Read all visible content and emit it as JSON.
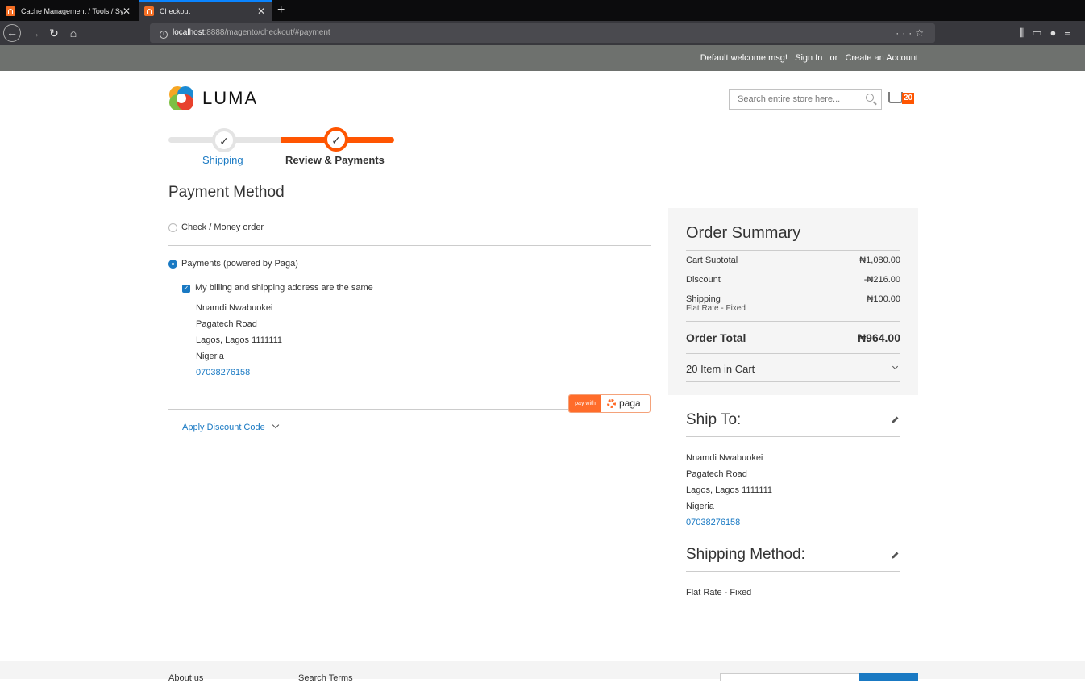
{
  "browser": {
    "tabs": [
      {
        "label": "Cache Management / Tools / Sy"
      },
      {
        "label": "Checkout"
      }
    ],
    "url_host": "localhost",
    "url_path": ":8888/magento/checkout/#payment"
  },
  "header": {
    "welcome": "Default welcome msg!",
    "sign_in": "Sign In",
    "or": "or",
    "create_account": "Create an Account",
    "logo_text": "LUMA",
    "search_placeholder": "Search entire store here...",
    "cart_count": "20"
  },
  "progress": {
    "steps": [
      {
        "label": "Shipping",
        "check": "✓"
      },
      {
        "label": "Review & Payments",
        "check": "✓"
      }
    ]
  },
  "payment": {
    "title": "Payment Method",
    "options": [
      {
        "label": "Check / Money order"
      },
      {
        "label": "Payments (powered by Paga)"
      }
    ],
    "same_address_label": "My billing and shipping address are the same",
    "address": {
      "name": "Nnamdi Nwabuokei",
      "street": "Pagatech Road",
      "city": "Lagos, Lagos 1111111",
      "country": "Nigeria",
      "phone": "07038276158"
    },
    "paga_button": {
      "pay_with": "pay with",
      "brand": "paga"
    },
    "discount_label": "Apply Discount Code"
  },
  "summary": {
    "title": "Order Summary",
    "rows": [
      {
        "label": "Cart Subtotal",
        "value": "₦1,080.00"
      },
      {
        "label": "Discount",
        "value": "-₦216.00"
      },
      {
        "label": "Shipping",
        "sub": "Flat Rate - Fixed",
        "value": "₦100.00"
      }
    ],
    "total_label": "Order Total",
    "total_value": "₦964.00",
    "items_in_cart": "20 Item in Cart"
  },
  "ship_to": {
    "title": "Ship To:",
    "name": "Nnamdi Nwabuokei",
    "street": "Pagatech Road",
    "city": "Lagos, Lagos 1111111",
    "country": "Nigeria",
    "phone": "07038276158"
  },
  "shipping_method": {
    "title": "Shipping Method:",
    "value": "Flat Rate - Fixed"
  },
  "footer": {
    "links": [
      "About us",
      "Search Terms"
    ]
  },
  "colors": {
    "accent": "#ff5501",
    "link": "#1979c3"
  }
}
